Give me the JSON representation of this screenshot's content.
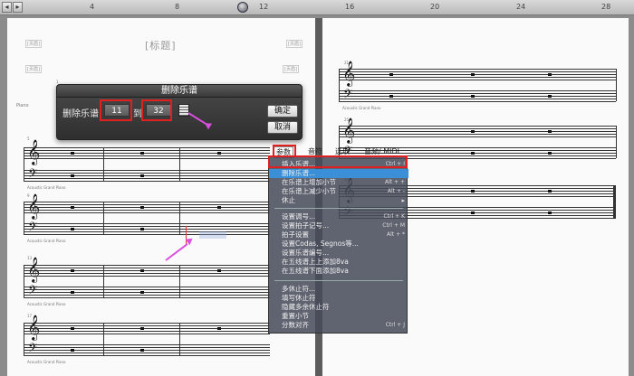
{
  "ruler": {
    "numbers": [
      "4",
      "8",
      "12",
      "16",
      "20",
      "24",
      "28"
    ],
    "left_button": "◂",
    "right_button": "▸"
  },
  "score": {
    "title_placeholder": "[标题]",
    "header_placeholder": "[页眉]",
    "instrument_label": "Piano",
    "instrument_caption": "Acoustic Grand Piano",
    "measure_numbers": [
      "1",
      "5",
      "9",
      "13",
      "17",
      "21",
      "25",
      "29"
    ]
  },
  "dialog": {
    "title": "删除乐谱",
    "from_label": "删除乐谱",
    "from_value": "11",
    "to_label": "到",
    "to_value": "32",
    "ok_label": "确定",
    "cancel_label": "取消"
  },
  "menubar": {
    "items": [
      "参数",
      "音符",
      "选项",
      "音频/ MIDI"
    ],
    "active": "参数"
  },
  "menu": {
    "items": [
      {
        "label": "插入乐谱...",
        "shortcut": "Ctrl + I"
      },
      {
        "label": "删除乐谱...",
        "shortcut": ""
      },
      {
        "label": "在乐谱上增加小节",
        "shortcut": "Alt + +"
      },
      {
        "label": "在乐谱上减少小节",
        "shortcut": "Alt + -"
      },
      {
        "label": "休止",
        "shortcut": ""
      },
      {
        "label": "设置调号...",
        "shortcut": "Ctrl + K"
      },
      {
        "label": "设置拍子记号...",
        "shortcut": "Ctrl + M"
      },
      {
        "label": "拍子设置",
        "shortcut": "Alt + *"
      },
      {
        "label": "设置Codas, Segnos等...",
        "shortcut": ""
      },
      {
        "label": "设置乐谱编号...",
        "shortcut": ""
      },
      {
        "label": "在五线谱上上添加8va",
        "shortcut": ""
      },
      {
        "label": "在五线谱下面添加8va",
        "shortcut": ""
      },
      {
        "label": "多休止符...",
        "shortcut": ""
      },
      {
        "label": "填写休止符",
        "shortcut": ""
      },
      {
        "label": "隐藏多余休止符",
        "shortcut": ""
      },
      {
        "label": "重置小节",
        "shortcut": ""
      },
      {
        "label": "分数对齐",
        "shortcut": "Ctrl + J"
      }
    ]
  },
  "colors": {
    "highlight_red": "#e02020",
    "arrow_magenta": "#d94fe0",
    "menu_highlight": "#3a8fd6"
  }
}
